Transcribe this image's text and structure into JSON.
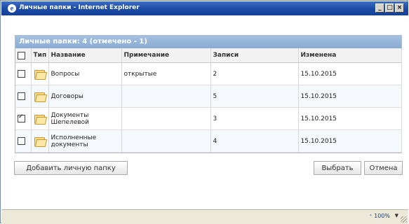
{
  "window": {
    "title": "Личные папки - Internet Explorer",
    "btn_min": "_",
    "btn_max": "□",
    "btn_close": "×"
  },
  "table": {
    "header": "Личные папки: 4 (отмечено - 1)",
    "columns": [
      "",
      "Тип",
      "Название",
      "Примечание",
      "Записи",
      "Изменена"
    ],
    "rows": [
      {
        "checked": false,
        "type_icon": "folder-icon",
        "name": "Вопросы",
        "note": "открытые",
        "records": "2",
        "modified": "15.10.2015"
      },
      {
        "checked": false,
        "type_icon": "folder-icon",
        "name": "Договоры",
        "note": "",
        "records": "5",
        "modified": "15.10.2015"
      },
      {
        "checked": true,
        "type_icon": "folder-icon",
        "name": "Документы Шепелевой",
        "note": "",
        "records": "3",
        "modified": "15.10.2015"
      },
      {
        "checked": false,
        "type_icon": "folder-icon",
        "name": "Исполненные документы",
        "note": "",
        "records": "4",
        "modified": "15.10.2015"
      }
    ]
  },
  "buttons": {
    "add": "Добавить личную папку",
    "select": "Выбрать",
    "cancel": "Отмена"
  },
  "status": {
    "zoom": "⁺ 100%",
    "zoom_arrow": "▼"
  },
  "colors": {
    "titlebar": "#1f4fa8",
    "table_header": "#8aabd3"
  }
}
